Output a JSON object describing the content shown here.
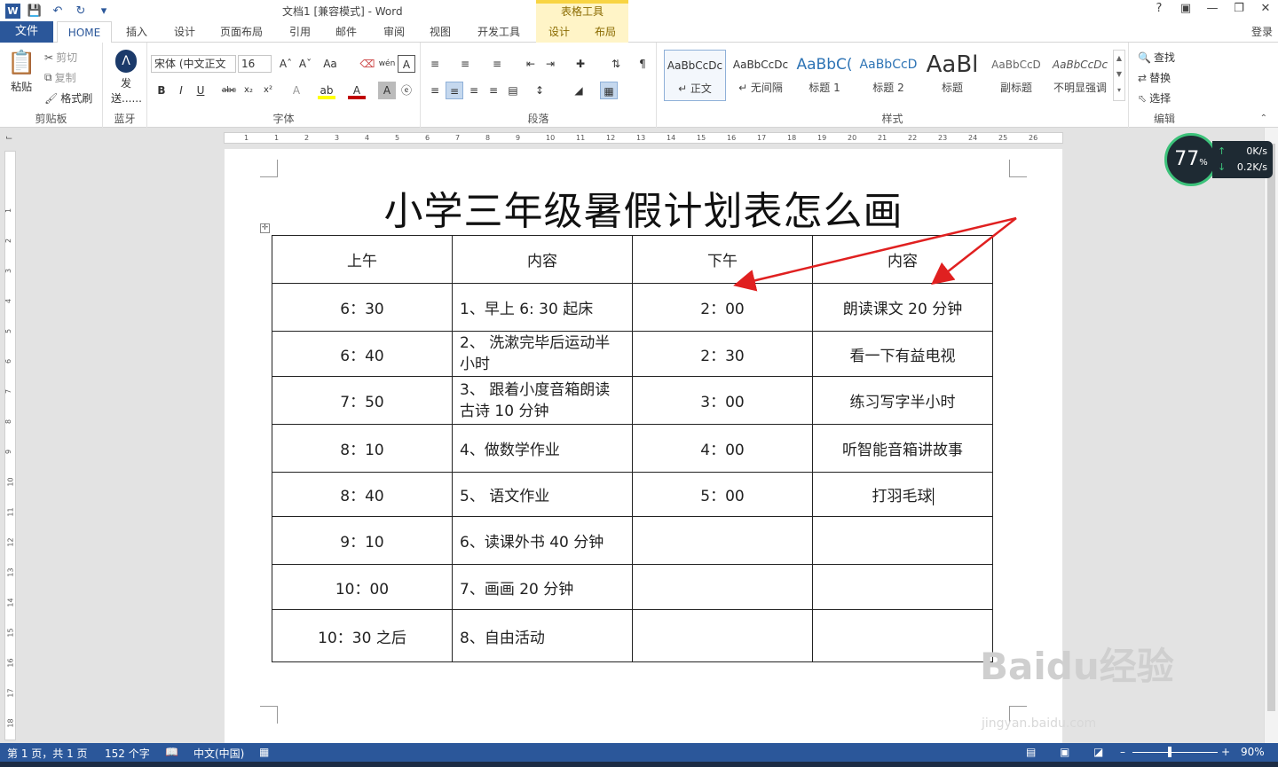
{
  "window": {
    "title": "文档1 [兼容模式] - Word",
    "context_tab_header": "表格工具",
    "account": "登录"
  },
  "tabs": {
    "file": "文件",
    "items": [
      "HOME",
      "插入",
      "设计",
      "页面布局",
      "引用",
      "邮件",
      "审阅",
      "视图",
      "开发工具",
      "设计",
      "布局"
    ]
  },
  "ribbon": {
    "clipboard": {
      "paste": "粘贴",
      "cut": "剪切",
      "copy": "复制",
      "format_painter": "格式刷",
      "label": "剪贴板"
    },
    "bluetooth": {
      "send": "发送......",
      "label": "蓝牙"
    },
    "font": {
      "name": "宋体 (中文正文",
      "size": "16",
      "label": "字体"
    },
    "paragraph": {
      "label": "段落"
    },
    "styles": {
      "items": [
        {
          "preview": "AaBbCcDc",
          "name": "↵ 正文"
        },
        {
          "preview": "AaBbCcDc",
          "name": "↵ 无间隔"
        },
        {
          "preview": "AaBbC(",
          "name": "标题 1"
        },
        {
          "preview": "AaBbCcD",
          "name": "标题 2"
        },
        {
          "preview": "AaBl",
          "name": "标题"
        },
        {
          "preview": "AaBbCcD",
          "name": "副标题"
        },
        {
          "preview": "AaBbCcDc",
          "name": "不明显强调"
        }
      ],
      "label": "样式"
    },
    "editing": {
      "find": "查找",
      "replace": "替换",
      "select": "选择",
      "label": "编辑"
    }
  },
  "ruler": {
    "h_ticks": [
      "1",
      "1",
      "2",
      "3",
      "4",
      "5",
      "6",
      "7",
      "8",
      "9",
      "10",
      "11",
      "12",
      "13",
      "14",
      "15",
      "16",
      "17",
      "18",
      "19",
      "20",
      "21",
      "22",
      "23",
      "24",
      "25",
      "26"
    ],
    "v_ticks": [
      "1",
      "2",
      "3",
      "4",
      "5",
      "6",
      "7",
      "8",
      "9",
      "10",
      "11",
      "12",
      "13",
      "14",
      "15",
      "16",
      "17",
      "18"
    ]
  },
  "document": {
    "heading": "小学三年级暑假计划表怎么画",
    "table": {
      "header": [
        "上午",
        "内容",
        "下午",
        "内容"
      ],
      "rows": [
        [
          "6：30",
          "1、早上 6: 30 起床",
          "2：00",
          "朗读课文 20 分钟"
        ],
        [
          "6：40",
          "2、 洗漱完毕后运动半小时",
          "2：30",
          "看一下有益电视"
        ],
        [
          "7：50",
          "3、 跟着小度音箱朗读古诗 10 分钟",
          "3：00",
          "练习写字半小时"
        ],
        [
          "8：10",
          "4、做数学作业",
          "4：00",
          "听智能音箱讲故事"
        ],
        [
          "8：40",
          "5、 语文作业",
          "5：00",
          "打羽毛球"
        ],
        [
          "9：10",
          "6、读课外书 40 分钟",
          "",
          ""
        ],
        [
          "10：00",
          "7、画画 20 分钟",
          "",
          ""
        ],
        [
          "10：30 之后",
          "8、自由活动",
          "",
          ""
        ]
      ]
    }
  },
  "speed_widget": {
    "percent": "77",
    "unit": "%",
    "up": "0K/s",
    "down": "0.2K/s"
  },
  "status": {
    "page": "第 1 页，共 1 页",
    "words": "152 个字",
    "language": "中文(中国)",
    "zoom": "90%"
  },
  "watermark": {
    "brand": "Baidu经验",
    "url": "jingyan.baidu.com"
  },
  "colors": {
    "word_blue": "#2b579a",
    "context_yellow": "#f8d443",
    "arrow_red": "#e02020"
  }
}
